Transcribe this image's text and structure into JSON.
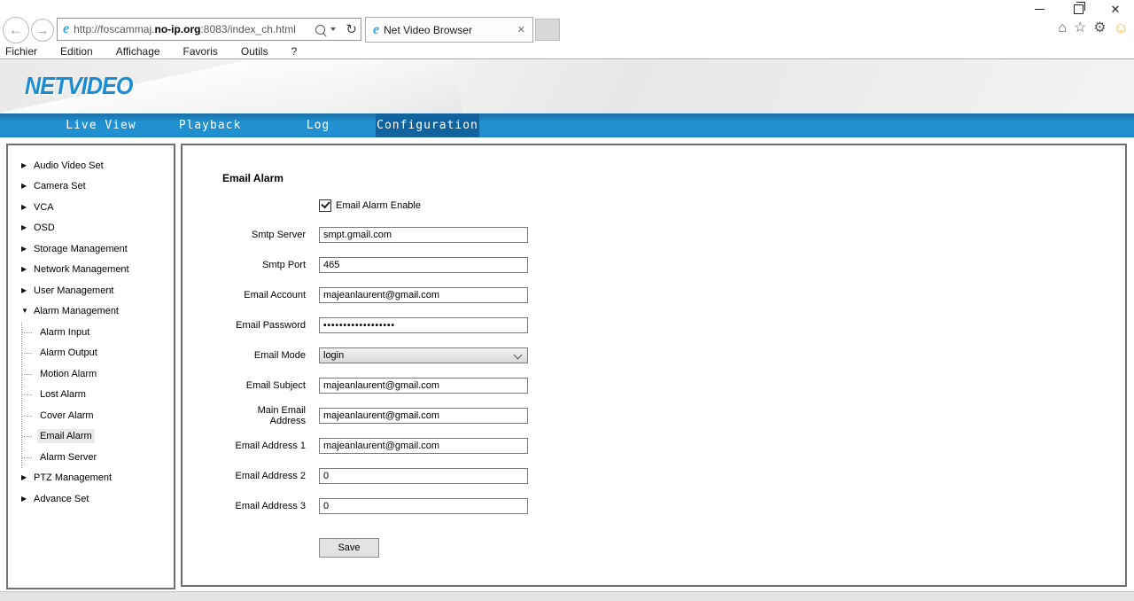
{
  "window": {
    "controls": [
      {
        "name": "minimize",
        "icon": "minimize-icon"
      },
      {
        "name": "restore",
        "icon": "restore-icon"
      },
      {
        "name": "close",
        "icon": "close-icon"
      }
    ]
  },
  "browser": {
    "back_icon": "arrow-left",
    "forward_icon": "arrow-right",
    "url": {
      "prefix": "http://foscammaj.",
      "bold": "no-ip.org",
      "suffix": ":8083/index_ch.html"
    },
    "search_icon": "magnifier",
    "refresh_icon": "refresh-arrow",
    "tab_title": "Net Video Browser",
    "tab_close_icon": "x",
    "toolbar_icons": [
      "home",
      "favorites-star",
      "settings-gear",
      "feedback-smiley"
    ],
    "menu_items": [
      "Fichier",
      "Edition",
      "Affichage",
      "Favoris",
      "Outils",
      "?"
    ]
  },
  "header": {
    "logo": "NETVIDEO"
  },
  "nav": {
    "tabs": [
      {
        "label": "Live View",
        "active": false
      },
      {
        "label": "Playback",
        "active": false
      },
      {
        "label": "Log",
        "active": false
      },
      {
        "label": "Configuration",
        "active": true
      }
    ]
  },
  "sidebar": {
    "items": [
      {
        "label": "Audio Video Set",
        "level": 0,
        "expanded": false,
        "selected": false
      },
      {
        "label": "Camera Set",
        "level": 0,
        "expanded": false,
        "selected": false
      },
      {
        "label": "VCA",
        "level": 0,
        "expanded": false,
        "selected": false
      },
      {
        "label": "OSD",
        "level": 0,
        "expanded": false,
        "selected": false
      },
      {
        "label": "Storage Management",
        "level": 0,
        "expanded": false,
        "selected": false
      },
      {
        "label": "Network Management",
        "level": 0,
        "expanded": false,
        "selected": false
      },
      {
        "label": "User Management",
        "level": 0,
        "expanded": false,
        "selected": false
      },
      {
        "label": "Alarm Management",
        "level": 0,
        "expanded": true,
        "selected": false
      },
      {
        "label": "Alarm Input",
        "level": 1,
        "selected": false
      },
      {
        "label": "Alarm Output",
        "level": 1,
        "selected": false
      },
      {
        "label": "Motion Alarm",
        "level": 1,
        "selected": false
      },
      {
        "label": "Lost Alarm",
        "level": 1,
        "selected": false
      },
      {
        "label": "Cover Alarm",
        "level": 1,
        "selected": false
      },
      {
        "label": "Email Alarm",
        "level": 1,
        "selected": true
      },
      {
        "label": "Alarm Server",
        "level": 1,
        "selected": false
      },
      {
        "label": "PTZ Management",
        "level": 0,
        "expanded": false,
        "selected": false
      },
      {
        "label": "Advance Set",
        "level": 0,
        "expanded": false,
        "selected": false
      }
    ]
  },
  "form": {
    "title": "Email Alarm",
    "enable_checkbox": {
      "label": "Email Alarm Enable",
      "checked": true
    },
    "fields": [
      {
        "label": "Smtp Server",
        "value": "smpt.gmail.com",
        "type": "text"
      },
      {
        "label": "Smtp Port",
        "value": "465",
        "type": "text"
      },
      {
        "label": "Email Account",
        "value": "majeanlaurent@gmail.com",
        "type": "text"
      },
      {
        "label": "Email Password",
        "value": "••••••••••••••••••",
        "type": "password"
      },
      {
        "label": "Email Mode",
        "value": "login",
        "type": "select"
      },
      {
        "label": "Email Subject",
        "value": "majeanlaurent@gmail.com",
        "type": "text"
      },
      {
        "label": "Main Email Address",
        "value": "majeanlaurent@gmail.com",
        "type": "text"
      },
      {
        "label": "Email Address 1",
        "value": "majeanlaurent@gmail.com",
        "type": "text"
      },
      {
        "label": "Email Address 2",
        "value": "0",
        "type": "text"
      },
      {
        "label": "Email Address 3",
        "value": "0",
        "type": "text"
      }
    ],
    "save_label": "Save"
  },
  "colors": {
    "nav_blue": "#2090d1",
    "nav_active_blue": "#10639c",
    "logo_blue": "#1b8ed3",
    "panel_border": "#6f6f6f",
    "status_bar": "#e3e3e3"
  }
}
